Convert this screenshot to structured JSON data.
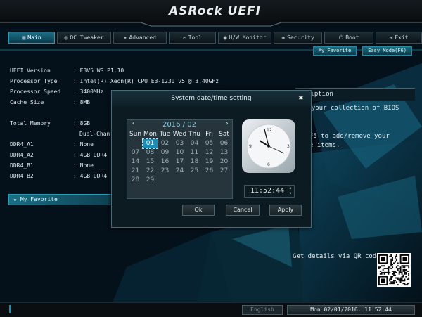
{
  "app": {
    "title": "ASRock UEFI"
  },
  "tabs": [
    {
      "label": "Main",
      "icon": "home-icon",
      "active": true
    },
    {
      "label": "OC Tweaker",
      "icon": "oc-icon"
    },
    {
      "label": "Advanced",
      "icon": "advanced-icon"
    },
    {
      "label": "Tool",
      "icon": "tool-icon"
    },
    {
      "label": "H/W Monitor",
      "icon": "monitor-icon"
    },
    {
      "label": "Security",
      "icon": "shield-icon"
    },
    {
      "label": "Boot",
      "icon": "boot-icon"
    },
    {
      "label": "Exit",
      "icon": "exit-icon"
    }
  ],
  "sub_buttons": {
    "favorite": "My Favorite",
    "easy_mode": "Easy Mode(F6)"
  },
  "info": [
    {
      "label": "UEFI Version",
      "value": ": E3V5 WS P1.10"
    },
    {
      "label": "Processor Type",
      "value": ": Intel(R) Xeon(R) CPU E3-1230 v5 @ 3.40GHz"
    },
    {
      "label": "Processor Speed",
      "value": ": 3400MHz"
    },
    {
      "label": "Cache Size",
      "value": ": 8MB"
    },
    {
      "label": "Total Memory",
      "value": ": 8GB"
    },
    {
      "label": "",
      "value": "Dual-Chan"
    },
    {
      "label": "DDR4_A1",
      "value": ": None"
    },
    {
      "label": "DDR4_A2",
      "value": ": 4GB DDR4"
    },
    {
      "label": "DDR4_B1",
      "value": ": None"
    },
    {
      "label": "DDR4_B2",
      "value": ": 4GB DDR4"
    }
  ],
  "my_favorite": "My Favorite",
  "description": {
    "header": "ription",
    "line1": "y your collection of BIOS",
    "line2": "F5 to add/remove your",
    "line3": "e items."
  },
  "modal": {
    "title": "System date/time setting",
    "close": "✖",
    "calendar": {
      "prev": "‹",
      "next": "›",
      "month_label": "2016 / 02",
      "weekdays": [
        "Sun",
        "Mon",
        "Tue",
        "Wed",
        "Thu",
        "Fri",
        "Sat"
      ],
      "weeks": [
        [
          "",
          "01",
          "02",
          "03",
          "04",
          "05",
          "06"
        ],
        [
          "07",
          "08",
          "09",
          "10",
          "11",
          "12",
          "13"
        ],
        [
          "14",
          "15",
          "16",
          "17",
          "18",
          "19",
          "20"
        ],
        [
          "21",
          "22",
          "23",
          "24",
          "25",
          "26",
          "27"
        ],
        [
          "28",
          "29",
          "",
          "",
          "",
          "",
          ""
        ]
      ],
      "selected_day": "01"
    },
    "time": "11:52:44",
    "spin_up": "▴",
    "spin_down": "▾",
    "buttons": {
      "ok": "Ok",
      "cancel": "Cancel",
      "apply": "Apply"
    }
  },
  "qr_text": "Get details via QR code",
  "footer": {
    "language": "English",
    "datetime": "Mon 02/01/2016. 11:52:44"
  },
  "colors": {
    "accent": "#1d8db3",
    "background": "#05121a",
    "tab_active": "#1c6f87"
  }
}
